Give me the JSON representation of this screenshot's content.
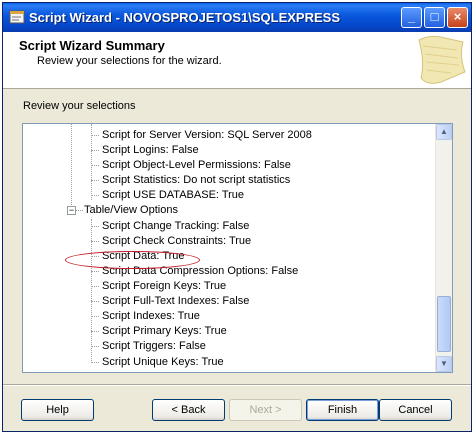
{
  "window": {
    "title": "Script Wizard - NOVOSPROJETOS1\\SQLEXPRESS"
  },
  "header": {
    "title": "Script Wizard Summary",
    "subtitle": "Review your selections for the wizard."
  },
  "review_label": "Review your selections",
  "tree_items": [
    "Script for Server Version: SQL Server 2008",
    "Script Logins: False",
    "Script Object-Level Permissions: False",
    "Script Statistics: Do not script statistics",
    "Script USE DATABASE: True",
    "Table/View Options",
    "Script Change Tracking: False",
    "Script Check Constraints: True",
    "Script Data: True",
    "Script Data Compression Options: False",
    "Script Foreign Keys: True",
    "Script Full-Text Indexes: False",
    "Script Indexes: True",
    "Script Primary Keys: True",
    "Script Triggers: False",
    "Script Unique Keys: True"
  ],
  "expander_symbol": "−",
  "buttons": {
    "help": "Help",
    "back": "< Back",
    "next": "Next >",
    "finish": "Finish",
    "cancel": "Cancel"
  },
  "titlebar_buttons": {
    "minimize": "_",
    "maximize": "□",
    "close": "×"
  },
  "colors": {
    "titlebar": "#0b59de",
    "highlight": "#c0202a"
  }
}
